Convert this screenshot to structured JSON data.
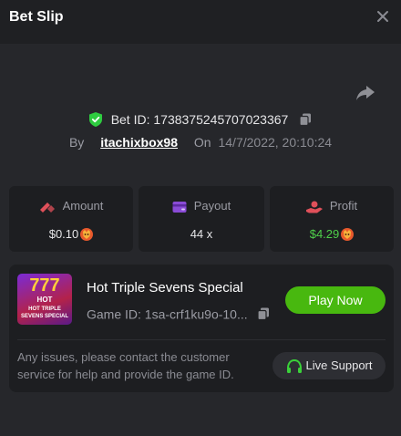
{
  "header": {
    "title": "Bet Slip",
    "close_icon": "close-icon"
  },
  "bet": {
    "id_label": "Bet ID:",
    "id_value": "1738375245707023367",
    "by_label": "By",
    "username": "itachixbox98",
    "on_label": "On",
    "datetime": "14/7/2022, 20:10:24"
  },
  "stats": {
    "amount_label": "Amount",
    "amount_value": "$0.10",
    "payout_label": "Payout",
    "payout_value": "44 x",
    "profit_label": "Profit",
    "profit_value": "$4.29"
  },
  "game": {
    "name": "Hot Triple Sevens Special",
    "id_text": "Game ID: 1sa-crf1ku9o-10...",
    "play_label": "Play Now",
    "thumb_number": "777",
    "thumb_hot": "HOT",
    "thumb_caption": "HOT TRIPLE SEVENS SPECIAL"
  },
  "support": {
    "message": "Any issues, please contact the customer service for help and provide the game ID.",
    "button_label": "Live Support"
  },
  "colors": {
    "accent_green": "#48b80f",
    "profit_green": "#4fcf4a",
    "shield_green": "#2ecc40",
    "amount_icon": "#e0505a",
    "payout_icon": "#8a4bd6",
    "profit_icon": "#e0505a"
  }
}
